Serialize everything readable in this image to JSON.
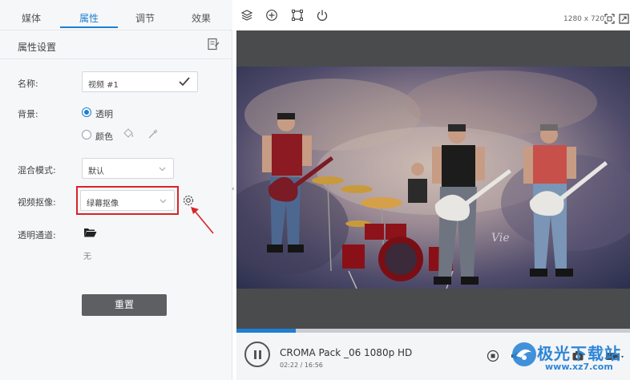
{
  "tabs": [
    {
      "label": "媒体"
    },
    {
      "label": "属性"
    },
    {
      "label": "调节"
    },
    {
      "label": "效果"
    }
  ],
  "active_tab": "属性",
  "panel": {
    "title": "属性设置",
    "name_label": "名称:",
    "name_value": "视频 #1",
    "background_label": "背景:",
    "bg_transparent": "透明",
    "bg_color": "颜色",
    "blend_label": "混合模式:",
    "blend_value": "默认",
    "matting_label": "视频抠像:",
    "matting_value": "绿幕抠像",
    "alpha_label": "透明通道:",
    "alpha_value": "无",
    "reset_label": "重置"
  },
  "preview": {
    "resolution": "1280 x 720",
    "progress_fraction": 0.15,
    "watermark_logo": "Vie"
  },
  "player": {
    "title": "CROMA Pack _06 1080p HD",
    "time": "02:22 / 16:56"
  },
  "watermark": {
    "name": "极光下载站",
    "url": "www.xz7.com"
  },
  "colors": {
    "accent": "#1d7fd2",
    "highlight_box": "#d9232a",
    "preview_bg": "#4a4b4d"
  }
}
